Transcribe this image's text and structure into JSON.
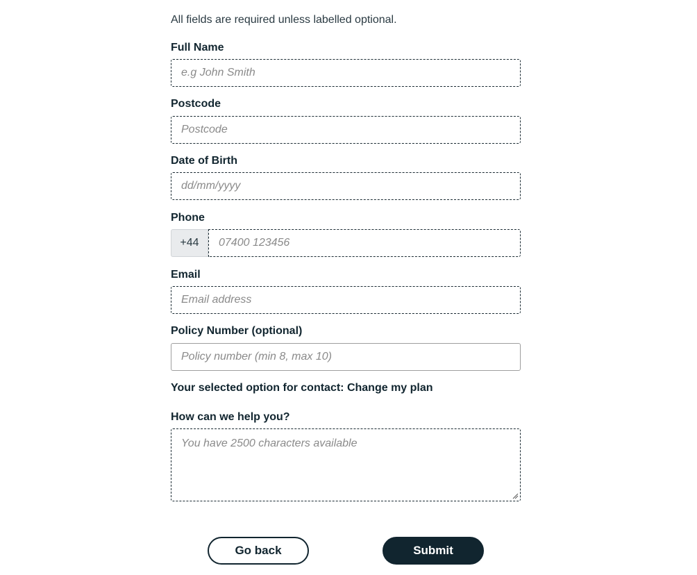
{
  "intro": "All fields are required unless labelled optional.",
  "fields": {
    "full_name": {
      "label": "Full Name",
      "placeholder": "e.g John Smith",
      "value": ""
    },
    "postcode": {
      "label": "Postcode",
      "placeholder": "Postcode",
      "value": ""
    },
    "dob": {
      "label": "Date of Birth",
      "placeholder": "dd/mm/yyyy",
      "value": ""
    },
    "phone": {
      "label": "Phone",
      "prefix": "+44",
      "placeholder": "07400 123456",
      "value": ""
    },
    "email": {
      "label": "Email",
      "placeholder": "Email address",
      "value": ""
    },
    "policy": {
      "label": "Policy Number (optional)",
      "placeholder": "Policy number (min 8, max 10)",
      "value": ""
    },
    "help": {
      "label": "How can we help you?",
      "placeholder": "You have 2500 characters available",
      "value": ""
    }
  },
  "contact_option": "Your selected option for contact: Change my plan",
  "buttons": {
    "back": "Go back",
    "submit": "Submit"
  },
  "icons": {
    "resize_handle": "resize-grip-icon"
  }
}
